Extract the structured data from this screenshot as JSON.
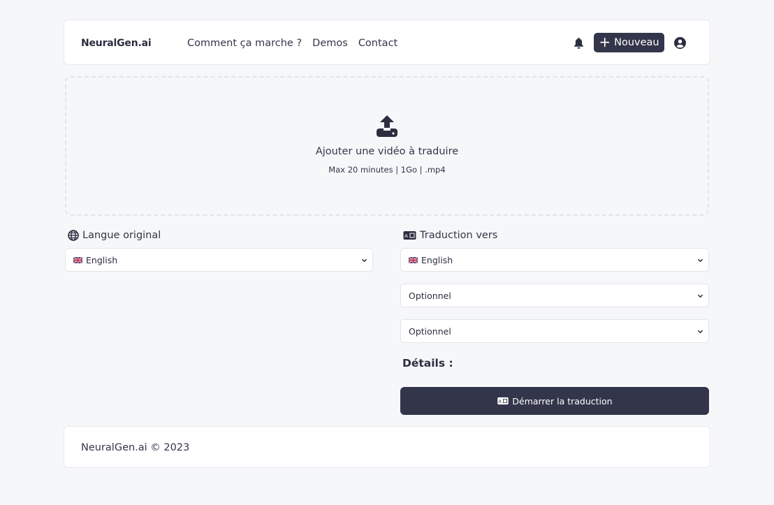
{
  "nav": {
    "brand": "NeuralGen.ai",
    "links": [
      "Comment ça marche ?",
      "Demos",
      "Contact"
    ],
    "new_button": "Nouveau",
    "new_icon": "plus-icon",
    "bell_icon": "bell-icon",
    "user_icon": "user-circle-icon"
  },
  "upload": {
    "icon": "upload-icon",
    "title": "Ajouter une vidéo à traduire",
    "subtitle": "Max 20 minutes | 1Go | .mp4"
  },
  "source": {
    "label": "Langue original",
    "icon": "globe-icon",
    "selected": "English",
    "flag": "uk-flag-icon"
  },
  "target": {
    "label": "Traduction vers",
    "icon": "translate-icon",
    "selects": [
      {
        "value": "English",
        "flag": "uk-flag-icon"
      },
      {
        "value": "Optionnel"
      },
      {
        "value": "Optionnel"
      }
    ]
  },
  "details_label": "Détails :",
  "start_button": "Démarrer la traduction",
  "footer": "NeuralGen.ai © 2023",
  "colors": {
    "primary": "#33354a",
    "background": "#f6f7f9",
    "surface": "#ffffff",
    "border": "#e3e4e8"
  }
}
